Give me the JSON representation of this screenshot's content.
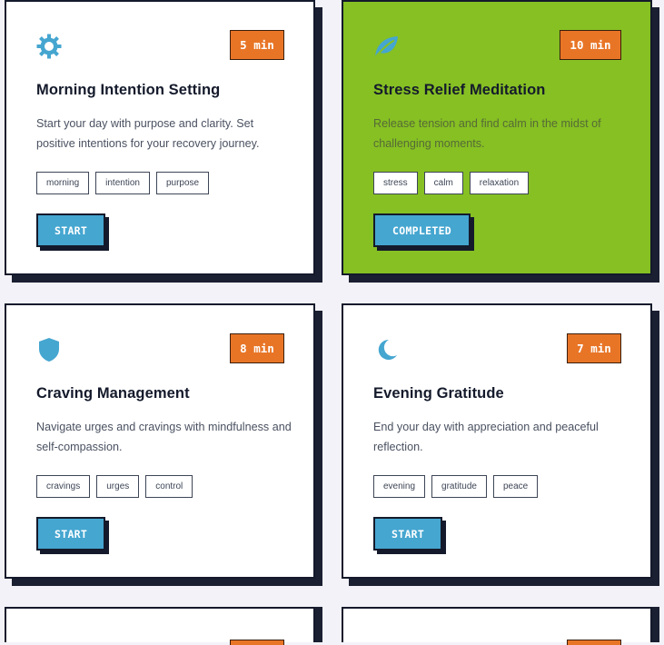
{
  "colors": {
    "card_bg": "#ffffff",
    "completed_bg": "#86c023",
    "duration_badge": "#e87526",
    "button": "#45a6d0",
    "icon": "#45a6d0",
    "border": "#141a2b"
  },
  "practices": [
    {
      "icon": "sun-icon",
      "duration": "5 min",
      "title": "Morning Intention Setting",
      "description": "Start your day with purpose and clarity. Set positive intentions for your recovery journey.",
      "tags": [
        "morning",
        "intention",
        "purpose"
      ],
      "button": "START",
      "completed": false
    },
    {
      "icon": "leaf-icon",
      "duration": "10 min",
      "title": "Stress Relief Meditation",
      "description": "Release tension and find calm in the midst of challenging moments.",
      "tags": [
        "stress",
        "calm",
        "relaxation"
      ],
      "button": "COMPLETED",
      "completed": true
    },
    {
      "icon": "shield-icon",
      "duration": "8 min",
      "title": "Craving Management",
      "description": "Navigate urges and cravings with mindfulness and self-compassion.",
      "tags": [
        "cravings",
        "urges",
        "control"
      ],
      "button": "START",
      "completed": false
    },
    {
      "icon": "moon-icon",
      "duration": "7 min",
      "title": "Evening Gratitude",
      "description": "End your day with appreciation and peaceful reflection.",
      "tags": [
        "evening",
        "gratitude",
        "peace"
      ],
      "button": "START",
      "completed": false
    }
  ]
}
